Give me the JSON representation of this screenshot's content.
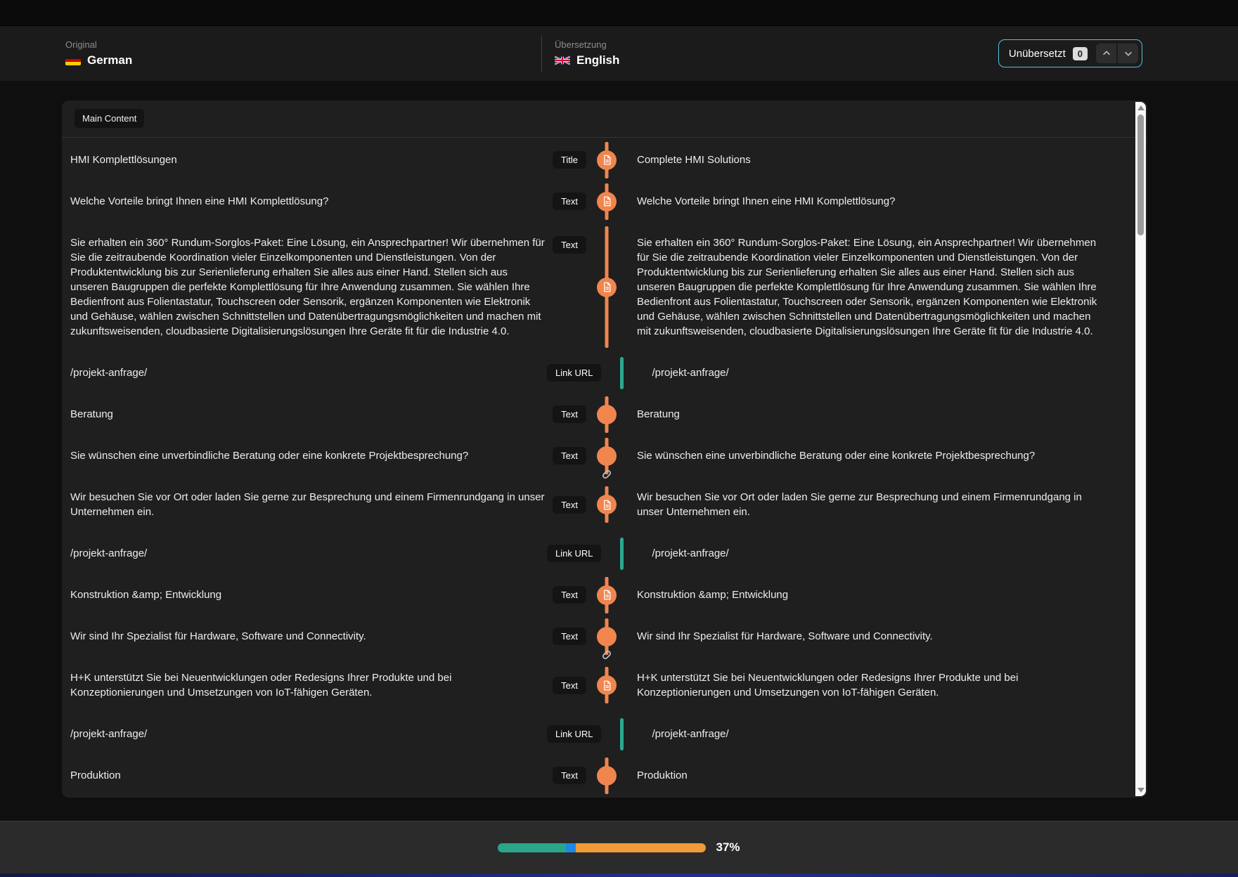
{
  "header": {
    "source_label": "Original",
    "source_language": "German",
    "target_label": "Übersetzung",
    "target_language": "English",
    "untranslated_label": "Unübersetzt",
    "untranslated_count": "0"
  },
  "panel": {
    "section_label": "Main Content",
    "rows": [
      {
        "source": "HMI Komplettlösungen",
        "type": "Title",
        "connector": "doc",
        "target": "Complete HMI Solutions"
      },
      {
        "source": "Welche Vorteile bringt Ihnen eine HMI Komplettlösung?",
        "type": "Text",
        "connector": "doc",
        "target": "Welche Vorteile bringt Ihnen eine HMI Komplettlösung?"
      },
      {
        "source": "Sie erhalten ein 360° Rundum-Sorglos-Paket: Eine Lösung, ein Ansprechpartner! Wir übernehmen für Sie die zeitraubende Koordination vieler Einzelkomponenten und Dienstleistungen. Von der Produktentwicklung bis zur Serienlieferung erhalten Sie alles aus einer Hand. Stellen sich aus unseren Baugruppen die perfekte Komplettlösung für Ihre Anwendung zusammen. Sie wählen Ihre Bedienfront aus Folientastatur, Touchscreen oder Sensorik, ergänzen Komponenten wie Elektronik und Gehäuse, wählen zwischen Schnittstellen und Datenübertragungsmöglichkeiten und machen mit zukunftsweisenden, cloudbasierte Digitalisierungslösungen Ihre Geräte fit für die Industrie 4.0.",
        "type": "Text",
        "connector": "doc",
        "tall": true,
        "target": "Sie erhalten ein 360° Rundum-Sorglos-Paket: Eine Lösung, ein Ansprechpartner! Wir übernehmen für Sie die zeitraubende Koordination vieler Einzelkomponenten und Dienstleistungen. Von der Produktentwicklung bis zur Serienlieferung erhalten Sie alles aus einer Hand. Stellen sich aus unseren Baugruppen die perfekte Komplettlösung für Ihre Anwendung zusammen. Sie wählen Ihre Bedienfront aus Folientastatur, Touchscreen oder Sensorik, ergänzen Komponenten wie Elektronik und Gehäuse, wählen zwischen Schnittstellen und Datenübertragungsmöglichkeiten und machen mit zukunftsweisenden, cloudbasierte Digitalisierungslösungen Ihre Geräte fit für die Industrie 4.0."
      },
      {
        "source": "/projekt-anfrage/",
        "type": "Link URL",
        "connector": "link",
        "target": "/projekt-anfrage/"
      },
      {
        "source": "Beratung",
        "type": "Text",
        "connector": "dot",
        "target": "Beratung"
      },
      {
        "source": "Sie wünschen eine unverbindliche Beratung oder eine konkrete Projektbesprechung?",
        "type": "Text",
        "connector": "dot",
        "target": "Sie wünschen eine unverbindliche Beratung oder eine konkrete Projektbesprechung?"
      },
      {
        "source": "Wir besuchen Sie vor Ort oder laden Sie gerne zur Besprechung und einem Firmenrundgang in unser Unternehmen ein.",
        "type": "Text",
        "connector": "doc",
        "chain_before": true,
        "target": "Wir besuchen Sie vor Ort oder laden Sie gerne zur Besprechung und einem Firmenrundgang in unser Unternehmen ein."
      },
      {
        "source": "/projekt-anfrage/",
        "type": "Link URL",
        "connector": "link",
        "target": "/projekt-anfrage/"
      },
      {
        "source": "Konstruktion &amp; Entwicklung",
        "type": "Text",
        "connector": "doc",
        "target": "Konstruktion &amp; Entwicklung"
      },
      {
        "source": "Wir sind Ihr Spezialist für Hardware, Software und Connectivity.",
        "type": "Text",
        "connector": "dot",
        "target": "Wir sind Ihr Spezialist für Hardware, Software und Connectivity."
      },
      {
        "source": "H+K unterstützt Sie bei Neuentwicklungen oder Redesigns Ihrer Produkte und bei Konzeptionierungen und Umsetzungen von IoT-fähigen Geräten.",
        "type": "Text",
        "connector": "doc",
        "chain_before": true,
        "target": "H+K unterstützt Sie bei Neuentwicklungen oder Redesigns Ihrer Produkte und bei Konzeptionierungen und Umsetzungen von IoT-fähigen Geräten."
      },
      {
        "source": "/projekt-anfrage/",
        "type": "Link URL",
        "connector": "link",
        "target": "/projekt-anfrage/"
      },
      {
        "source": "Produktion",
        "type": "Text",
        "connector": "dot",
        "target": "Produktion"
      }
    ]
  },
  "footer": {
    "progress_label": "37%",
    "progress_segments": [
      {
        "name": "translated",
        "color": "#2aa58a",
        "pct": 32.5
      },
      {
        "name": "review",
        "color": "#1e88e5",
        "pct": 5
      },
      {
        "name": "untranslated",
        "color": "#f09a38",
        "pct": 62.5
      }
    ]
  },
  "colors": {
    "accent_orange": "#f0854e",
    "link_teal": "#2ba98f",
    "focus_cyan": "#55c3dc",
    "progress_teal": "#2aa58a",
    "progress_blue": "#1e88e5",
    "progress_orange": "#f09a38"
  }
}
